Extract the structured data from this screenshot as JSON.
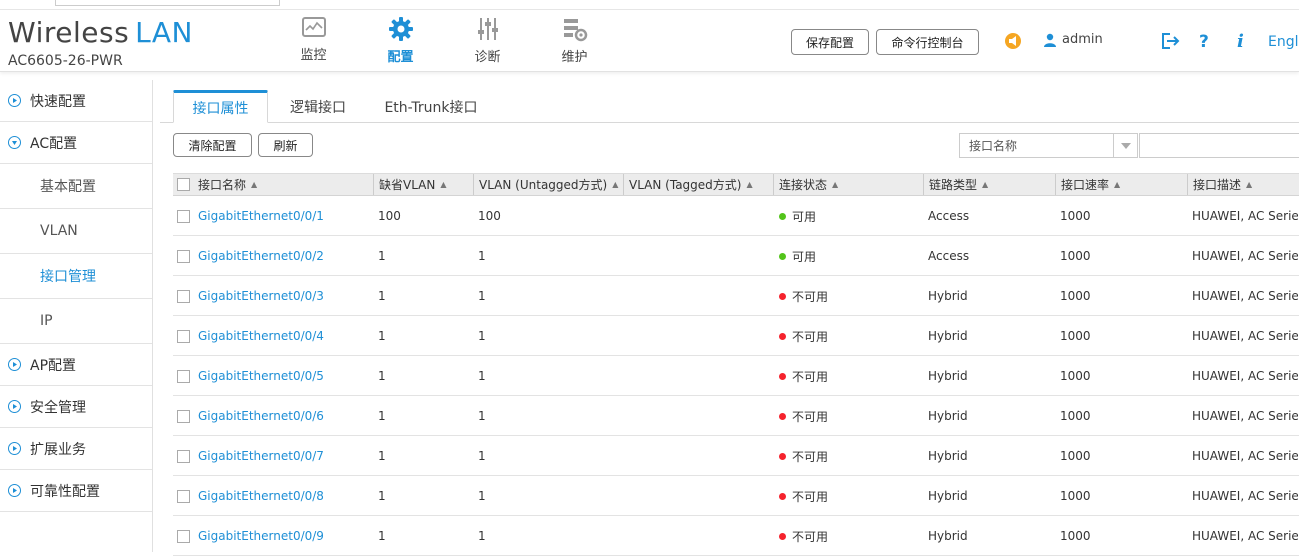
{
  "header": {
    "brand_main": "Wireless",
    "brand_accent": "LAN",
    "model": "AC6605-26-PWR",
    "nav": [
      {
        "label": "监控",
        "icon": "monitor-icon"
      },
      {
        "label": "配置",
        "icon": "gear-icon",
        "active": true
      },
      {
        "label": "诊断",
        "icon": "sliders-icon"
      },
      {
        "label": "维护",
        "icon": "maintenance-icon"
      }
    ],
    "save_config": "保存配置",
    "cli_console": "命令行控制台",
    "user": "admin",
    "language": "Engl",
    "accent_color": "#1e8fd6",
    "alert_color": "#f5a623"
  },
  "sidebar": {
    "items": [
      {
        "label": "快速配置"
      },
      {
        "label": "AC配置"
      },
      {
        "label": "基本配置"
      },
      {
        "label": "VLAN"
      },
      {
        "label": "接口管理"
      },
      {
        "label": "IP"
      },
      {
        "label": "AP配置"
      },
      {
        "label": "安全管理"
      },
      {
        "label": "扩展业务"
      },
      {
        "label": "可靠性配置"
      }
    ]
  },
  "tabs": [
    "接口属性",
    "逻辑接口",
    "Eth-Trunk接口"
  ],
  "toolbar": {
    "clear": "清除配置",
    "refresh": "刷新",
    "filter_value": "接口名称"
  },
  "table": {
    "columns": [
      "接口名称",
      "缺省VLAN",
      "VLAN (Untagged方式)",
      "VLAN (Tagged方式)",
      "连接状态",
      "链路类型",
      "接口速率",
      "接口描述"
    ],
    "status_colors": {
      "可用": "#52c41a",
      "不可用": "#f5222d"
    },
    "rows": [
      {
        "name": "GigabitEthernet0/0/1",
        "pvid": "100",
        "untagged": "100",
        "tagged": "",
        "status": "可用",
        "link": "Access",
        "speed": "1000",
        "desc": "HUAWEI, AC Serie..."
      },
      {
        "name": "GigabitEthernet0/0/2",
        "pvid": "1",
        "untagged": "1",
        "tagged": "",
        "status": "可用",
        "link": "Access",
        "speed": "1000",
        "desc": "HUAWEI, AC Serie..."
      },
      {
        "name": "GigabitEthernet0/0/3",
        "pvid": "1",
        "untagged": "1",
        "tagged": "",
        "status": "不可用",
        "link": "Hybrid",
        "speed": "1000",
        "desc": "HUAWEI, AC Serie..."
      },
      {
        "name": "GigabitEthernet0/0/4",
        "pvid": "1",
        "untagged": "1",
        "tagged": "",
        "status": "不可用",
        "link": "Hybrid",
        "speed": "1000",
        "desc": "HUAWEI, AC Serie..."
      },
      {
        "name": "GigabitEthernet0/0/5",
        "pvid": "1",
        "untagged": "1",
        "tagged": "",
        "status": "不可用",
        "link": "Hybrid",
        "speed": "1000",
        "desc": "HUAWEI, AC Serie..."
      },
      {
        "name": "GigabitEthernet0/0/6",
        "pvid": "1",
        "untagged": "1",
        "tagged": "",
        "status": "不可用",
        "link": "Hybrid",
        "speed": "1000",
        "desc": "HUAWEI, AC Serie..."
      },
      {
        "name": "GigabitEthernet0/0/7",
        "pvid": "1",
        "untagged": "1",
        "tagged": "",
        "status": "不可用",
        "link": "Hybrid",
        "speed": "1000",
        "desc": "HUAWEI, AC Serie..."
      },
      {
        "name": "GigabitEthernet0/0/8",
        "pvid": "1",
        "untagged": "1",
        "tagged": "",
        "status": "不可用",
        "link": "Hybrid",
        "speed": "1000",
        "desc": "HUAWEI, AC Serie..."
      },
      {
        "name": "GigabitEthernet0/0/9",
        "pvid": "1",
        "untagged": "1",
        "tagged": "",
        "status": "不可用",
        "link": "Hybrid",
        "speed": "1000",
        "desc": "HUAWEI, AC Serie..."
      }
    ]
  }
}
